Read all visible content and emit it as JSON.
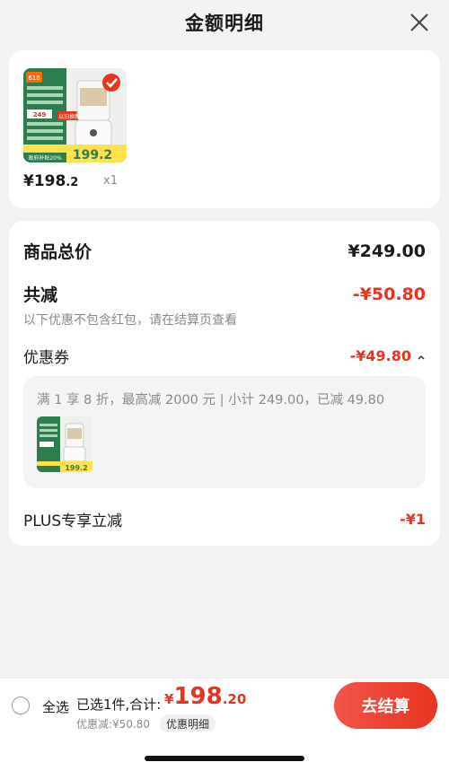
{
  "header": {
    "title": "金额明细"
  },
  "product": {
    "unit_price": "¥198",
    "unit_price_decimal": ".2",
    "quantity": "x1",
    "thumb_labels": {
      "badge": "618",
      "promo": "以旧换新立减5元",
      "price_tag": "249",
      "big_price": "199.2",
      "big_price_suffix": "到手价",
      "bottom_banner": "政府补贴20%"
    }
  },
  "summary": {
    "total_label": "商品总价",
    "total_value": "¥249.00",
    "reduce_label": "共减",
    "reduce_value": "-¥50.80",
    "reduce_note": "以下优惠不包含红包，请在结算页查看",
    "coupon_label": "优惠券",
    "coupon_value": "-¥49.80",
    "coupon_desc": "满 1 享 8 折，最高减 2000 元 | 小计 249.00，已减 49.80",
    "plus_label": "PLUS专享立减",
    "plus_value": "-¥1"
  },
  "bottom": {
    "select_all": "全选",
    "selected_text": "已选1件,合计:",
    "total_currency": "¥",
    "total_int": "198",
    "total_dec": ".20",
    "discount_text": "优惠减:¥50.80",
    "detail_tag": "优惠明细",
    "checkout_label": "去结算"
  },
  "colors": {
    "accent": "#e8331f",
    "background": "#f2f2f2"
  }
}
